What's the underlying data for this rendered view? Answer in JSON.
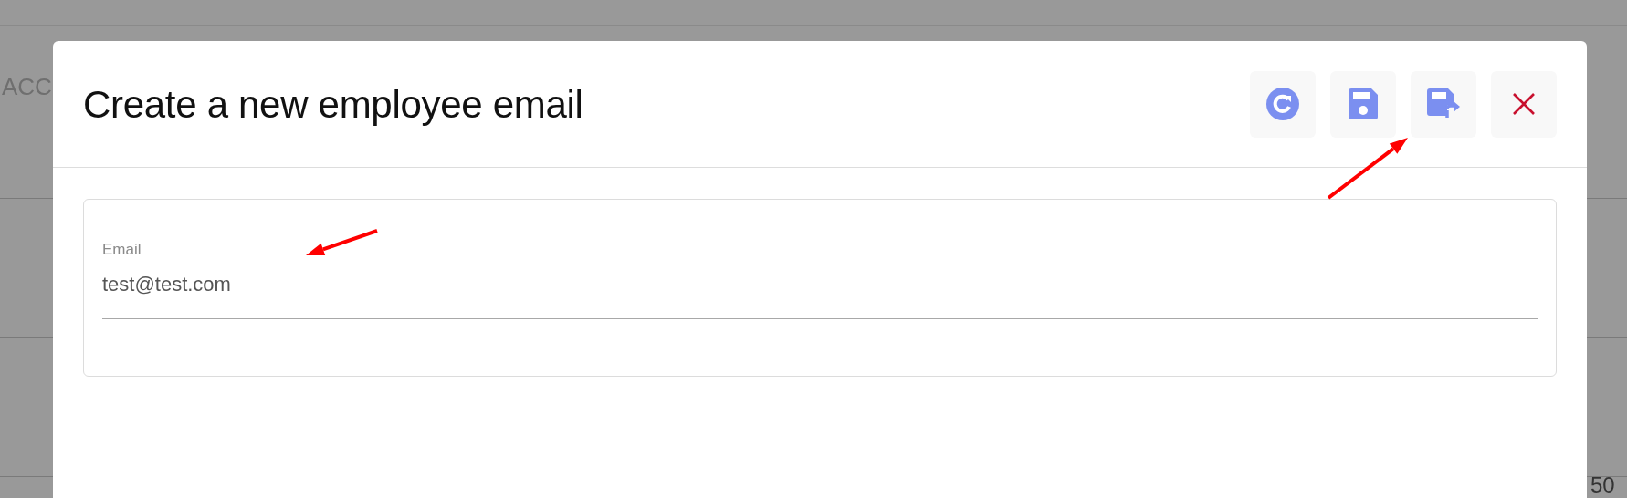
{
  "background": {
    "header_fragment": "ACC",
    "page_number": "50"
  },
  "dialog": {
    "title": "Create a new employee email",
    "toolbar_buttons": [
      {
        "kind": "refresh"
      },
      {
        "kind": "save"
      },
      {
        "kind": "save_and_close"
      },
      {
        "kind": "close"
      }
    ],
    "field": {
      "label": "Email",
      "value": "test@test.com"
    }
  },
  "annotations": [
    {
      "kind": "arrow"
    },
    {
      "kind": "arrow"
    }
  ]
}
